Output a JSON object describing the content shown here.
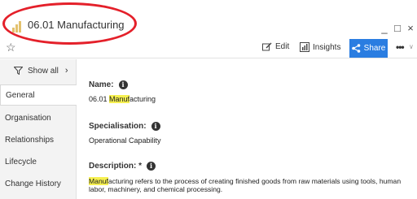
{
  "window": {
    "title": "06.01 Manufacturing",
    "controls": {
      "minimize": "_",
      "maximize": "□",
      "close": "×"
    }
  },
  "toolbar": {
    "edit_label": "Edit",
    "insights_label": "Insights",
    "share_label": "Share",
    "more_label": "•••"
  },
  "sidebar": {
    "show_all": "Show all",
    "items": [
      {
        "label": "General"
      },
      {
        "label": "Organisation"
      },
      {
        "label": "Relationships"
      },
      {
        "label": "Lifecycle"
      },
      {
        "label": "Change History"
      }
    ]
  },
  "fields": {
    "name": {
      "label": "Name:",
      "value_highlight": "Manuf",
      "value_prefix": "06.01 ",
      "value_rest": "acturing"
    },
    "specialisation": {
      "label": "Specialisation:",
      "value": "Operational Capability"
    },
    "description": {
      "label": "Description: *",
      "value_highlight": "Manuf",
      "value_rest": "acturing refers to the process of creating finished goods from raw materials using tools, human labor, machinery, and chemical processing."
    }
  },
  "colors": {
    "accent": "#2a7de1",
    "highlight": "#f6f050",
    "annotation": "#e4202a"
  }
}
